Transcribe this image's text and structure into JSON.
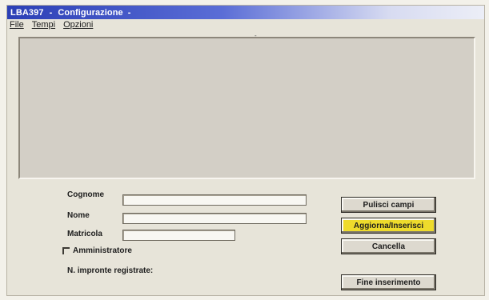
{
  "window": {
    "app_name": "LBA397",
    "separator": "-",
    "title": "Configurazione",
    "title_suffix": "-"
  },
  "menu": [
    {
      "label": "File"
    },
    {
      "label": "Tempi"
    },
    {
      "label": "Opzioni"
    }
  ],
  "decor": {
    "mark": "-"
  },
  "form": {
    "surname_label": "Cognome",
    "surname_value": "",
    "name_label": "Nome",
    "name_value": "",
    "badge_label": "Matricola",
    "badge_value": "",
    "admin_label": "Amministratore",
    "admin_checked": false,
    "fingerprints_label": "N. impronte registrate:"
  },
  "buttons": {
    "clear": "Pulisci campi",
    "update": "Aggiorna/Inserisci",
    "delete": "Cancella",
    "finish": "Fine inserimento"
  },
  "colors": {
    "title_bar": "#2b3fb6",
    "highlight_button": "#eedb2c",
    "window_bg": "#e7e4d9",
    "list_bg": "#d3cfc6"
  }
}
